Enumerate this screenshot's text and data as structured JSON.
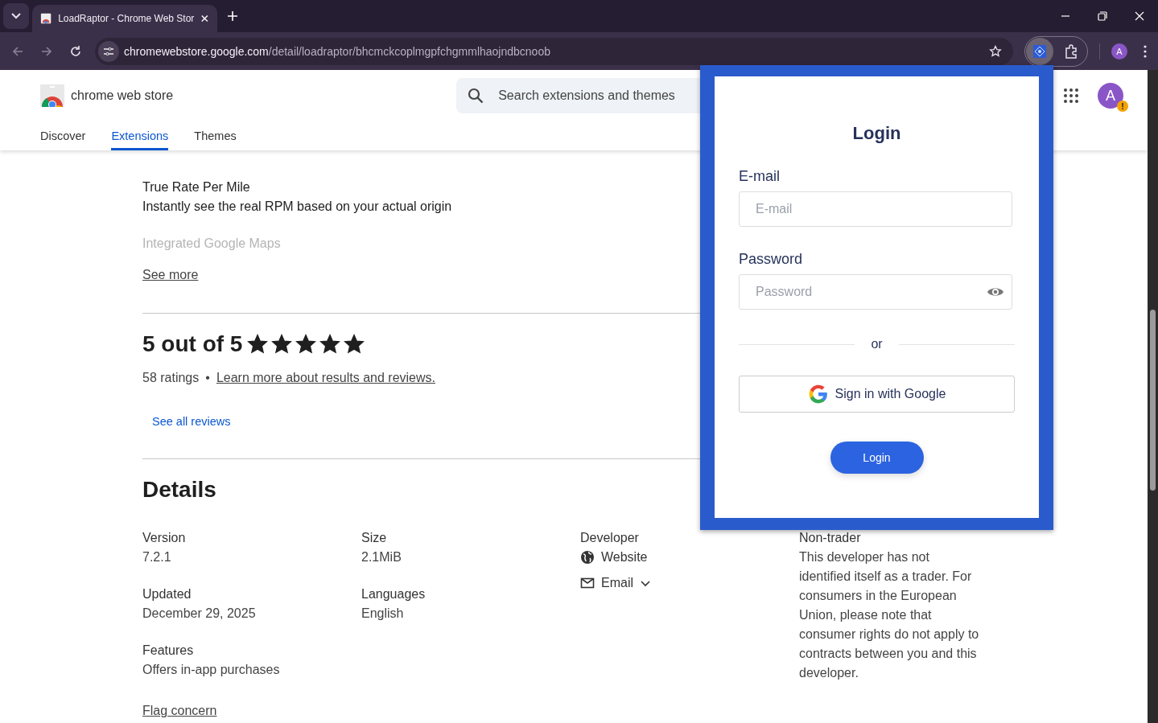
{
  "browser": {
    "tab_title": "LoadRaptor - Chrome Web Stor",
    "url_host": "chromewebstore.google.com",
    "url_path": "/detail/loadraptor/bhcmckcoplmgpfchgmmlhaojndbcnoob",
    "profile_initial": "A"
  },
  "store": {
    "name": "chrome web store",
    "search_placeholder": "Search extensions and themes",
    "avatar_initial": "A",
    "avatar_badge": "!",
    "nav": [
      {
        "label": "Discover",
        "selected": false
      },
      {
        "label": "Extensions",
        "selected": true
      },
      {
        "label": "Themes",
        "selected": false
      }
    ]
  },
  "description": {
    "paragraphs": [
      {
        "lines": [
          "True Rate Per Mile",
          "Instantly see the real RPM based on your actual origin"
        ],
        "faded": false
      },
      {
        "lines": [
          "Integrated Google Maps"
        ],
        "faded": true
      }
    ],
    "see_more": "See more"
  },
  "rating": {
    "title": "5 out of 5",
    "stars": 5,
    "count": "58 ratings",
    "separator": "•",
    "learn_more": "Learn more about results and reviews.",
    "see_all": "See all reviews"
  },
  "details": {
    "title": "Details",
    "columns": [
      [
        {
          "kind": "text",
          "label": "Version",
          "value": "7.2.1"
        },
        {
          "kind": "text",
          "label": "Updated",
          "value": "December 29, 2025"
        },
        {
          "kind": "text",
          "label": "Features",
          "value": "Offers in-app purchases"
        }
      ],
      [
        {
          "kind": "text",
          "label": "Size",
          "value": "2.1MiB"
        },
        {
          "kind": "text",
          "label": "Languages",
          "value": "English"
        }
      ],
      [
        {
          "kind": "links",
          "label": "Developer",
          "links": [
            {
              "kind": "website",
              "text": "Website",
              "dropdown": false
            },
            {
              "kind": "email",
              "text": "Email",
              "dropdown": true
            }
          ]
        }
      ],
      [
        {
          "kind": "text",
          "label": "Non-trader",
          "value": "This developer has not identified itself as a trader. For consumers in the European Union, please note that consumer rights do not apply to contracts between you and this developer."
        }
      ]
    ]
  },
  "flag": "Flag concern",
  "popup": {
    "title": "Login",
    "fields": [
      {
        "kind": "text",
        "label": "E-mail",
        "placeholder": "E-mail"
      },
      {
        "kind": "password",
        "label": "Password",
        "placeholder": "Password"
      }
    ],
    "divider": "or",
    "google_button": "Sign in with Google",
    "submit": "Login"
  }
}
